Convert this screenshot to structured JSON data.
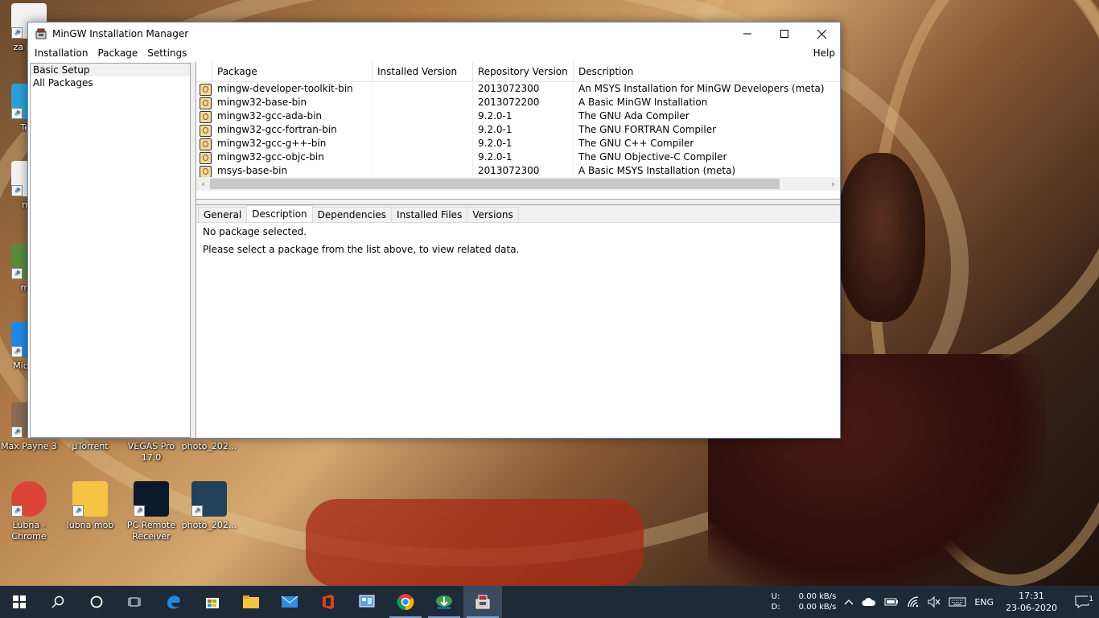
{
  "desktop": {
    "icons": [
      {
        "label": "za insu",
        "type": "pdf"
      },
      {
        "label": "Tele",
        "type": "telegram"
      },
      {
        "label": "mu",
        "type": "pdf"
      },
      {
        "label": "min",
        "type": "minecraft"
      },
      {
        "label": "Micr Ec",
        "type": "edge"
      },
      {
        "label": "Max Payne 3",
        "type": "game"
      },
      {
        "label": "µTorrent",
        "type": "utorrent"
      },
      {
        "label": "VEGAS Pro 17.0",
        "type": "vegas"
      },
      {
        "label": "photo_202...",
        "type": "photo"
      },
      {
        "label": "Lubna - Chrome",
        "type": "chrome"
      },
      {
        "label": "lubna mob",
        "type": "folder"
      },
      {
        "label": "PC Remote Receiver",
        "type": "remote"
      },
      {
        "label": "photo_202...",
        "type": "photo"
      }
    ]
  },
  "window": {
    "title": "MinGW Installation Manager",
    "controls": {
      "minimize": "—",
      "maximize": "☐",
      "close": "✕"
    },
    "menu": [
      "Installation",
      "Package",
      "Settings"
    ],
    "help": "Help",
    "sidebar": {
      "items": [
        {
          "label": "Basic Setup",
          "selected": true
        },
        {
          "label": "All Packages",
          "selected": false
        }
      ]
    },
    "columns": [
      "Package",
      "Installed Version",
      "Repository Version",
      "Description"
    ],
    "packages": [
      {
        "name": "mingw-developer-toolkit-bin",
        "installed": "",
        "repo": "2013072300",
        "desc": "An MSYS Installation for MinGW Developers (meta)"
      },
      {
        "name": "mingw32-base-bin",
        "installed": "",
        "repo": "2013072200",
        "desc": "A Basic MinGW Installation"
      },
      {
        "name": "mingw32-gcc-ada-bin",
        "installed": "",
        "repo": "9.2.0-1",
        "desc": "The GNU Ada Compiler"
      },
      {
        "name": "mingw32-gcc-fortran-bin",
        "installed": "",
        "repo": "9.2.0-1",
        "desc": "The GNU FORTRAN Compiler"
      },
      {
        "name": "mingw32-gcc-g++-bin",
        "installed": "",
        "repo": "9.2.0-1",
        "desc": "The GNU C++ Compiler"
      },
      {
        "name": "mingw32-gcc-objc-bin",
        "installed": "",
        "repo": "9.2.0-1",
        "desc": "The GNU Objective-C Compiler"
      },
      {
        "name": "msys-base-bin",
        "installed": "",
        "repo": "2013072300",
        "desc": "A Basic MSYS Installation (meta)"
      }
    ],
    "tabs": [
      {
        "label": "General",
        "active": false
      },
      {
        "label": "Description",
        "active": true
      },
      {
        "label": "Dependencies",
        "active": false
      },
      {
        "label": "Installed Files",
        "active": false
      },
      {
        "label": "Versions",
        "active": false
      }
    ],
    "detail": {
      "line1": "No package selected.",
      "line2": "Please select a package from the list above, to view related data."
    }
  },
  "taskbar": {
    "apps": [
      "start",
      "search",
      "cortana",
      "task-view",
      "edge",
      "store",
      "file-explorer",
      "mail",
      "office",
      "control-panel",
      "chrome",
      "idm",
      "mingw"
    ],
    "network": {
      "up_label": "U:",
      "up_value": "0.00 kB/s",
      "down_label": "D:",
      "down_value": "0.00 kB/s"
    },
    "language": "ENG",
    "time": "17:31",
    "date": "23-06-2020",
    "notifications": "1"
  }
}
